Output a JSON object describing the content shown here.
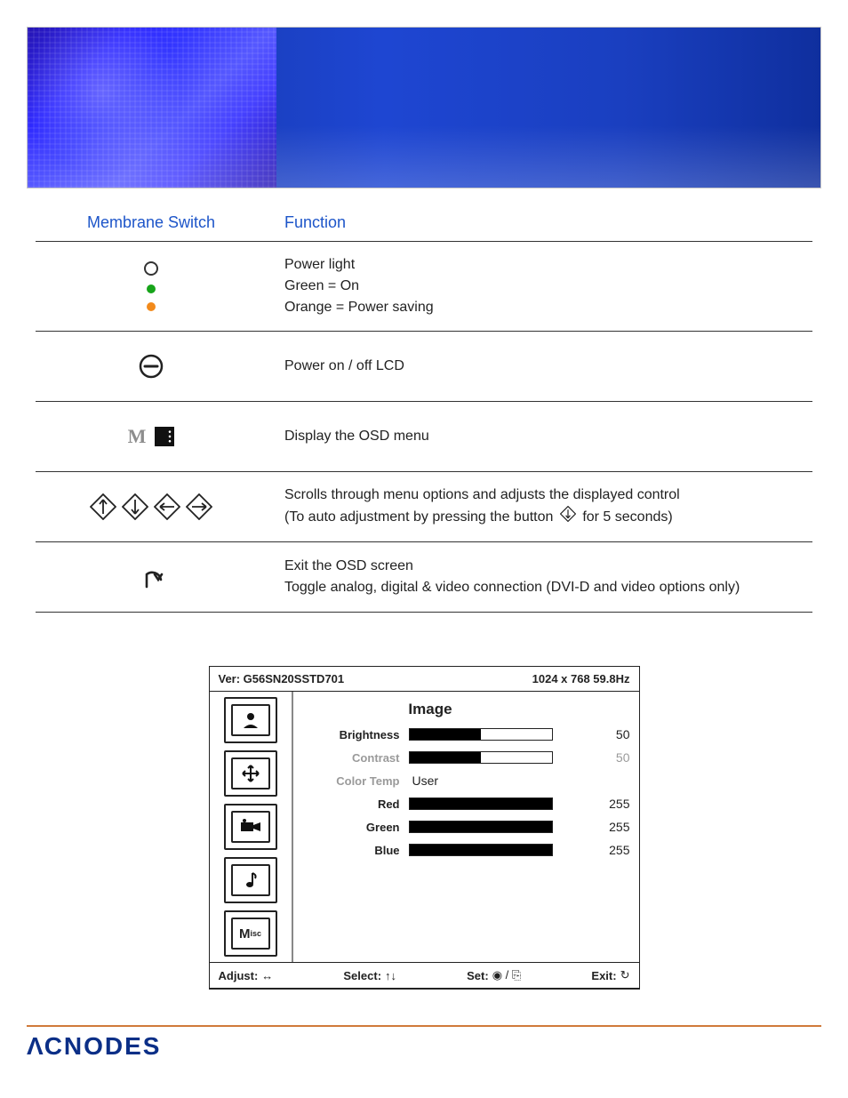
{
  "table": {
    "headers": {
      "left": "Membrane  Switch",
      "right": "Function"
    },
    "rows": {
      "power_light": {
        "line1": "Power light",
        "line2": "Green = On",
        "line3": "Orange = Power saving"
      },
      "power_button": {
        "text": "Power on / off LCD"
      },
      "osd_menu": {
        "text": "Display the OSD menu"
      },
      "arrows": {
        "line1": "Scrolls through menu options and adjusts the displayed control",
        "line2a": "(To auto adjustment by pressing the button",
        "line2b": "for 5 seconds)"
      },
      "exit": {
        "line1": "Exit the OSD screen",
        "line2": "Toggle analog, digital & video connection (DVI-D and video options only)"
      }
    }
  },
  "osd": {
    "version": "Ver: G56SN20SSTD701",
    "resolution": "1024 x 768  59.8Hz",
    "title": "Image",
    "items": {
      "brightness": {
        "label": "Brightness",
        "value": 50,
        "max": 100
      },
      "contrast": {
        "label": "Contrast",
        "value": 50,
        "max": 100
      },
      "color_temp": {
        "label": "Color Temp",
        "value": "User"
      },
      "red": {
        "label": "Red",
        "value": 255,
        "max": 255
      },
      "green": {
        "label": "Green",
        "value": 255,
        "max": 255
      },
      "blue": {
        "label": "Blue",
        "value": 255,
        "max": 255
      }
    },
    "footer": {
      "adjust": "Adjust:",
      "select": "Select:",
      "set": "Set:",
      "exit": "Exit:"
    },
    "sidebar": {
      "misc_label": "Misc"
    }
  },
  "brand": {
    "name": "ACNODES"
  }
}
